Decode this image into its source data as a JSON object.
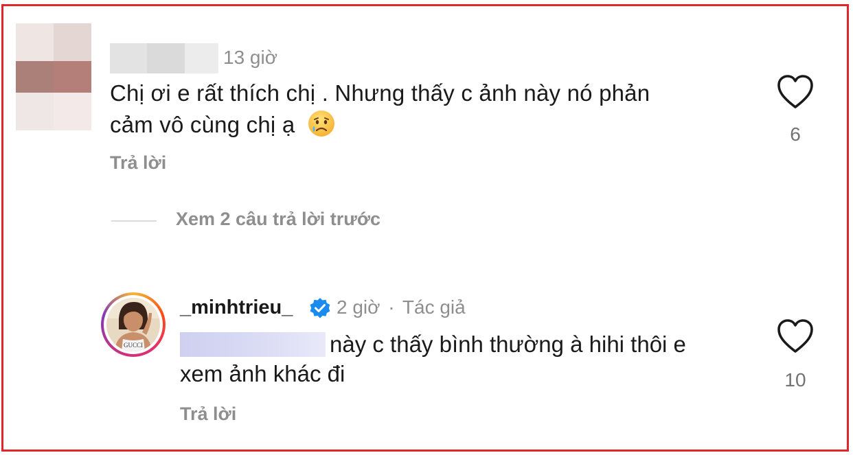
{
  "comment1": {
    "time": "13 giờ",
    "text_line1": "Chị ơi e rất thích chị . Nhưng thấy c ảnh này nó phản",
    "text_line2": "cảm vô cùng chị ạ",
    "emoji": "crying-face-emoji",
    "reply_label": "Trả lời",
    "like_count": "6",
    "like_icon": "heart-outline-icon",
    "avatar_blur_colors": [
      "#efe6e4",
      "#e3d6d3",
      "#ab8078",
      "#b57f79",
      "#efe7e5",
      "#f3e9e8"
    ],
    "name_blur_colors": [
      "#e3e3e3",
      "#dadada",
      "#ececec"
    ]
  },
  "view_replies": {
    "label": "Xem 2 câu trả lời trước"
  },
  "comment2": {
    "username": "_minhtrieu_",
    "verified_icon": "verified-badge-icon",
    "time": "2 giờ",
    "separator": "·",
    "author_tag": "Tác giả",
    "text_line1": "này c thấy bình thường à hihi thôi e",
    "text_line2": "xem ảnh khác đi",
    "reply_label": "Trả lời",
    "like_count": "10",
    "like_icon": "heart-outline-icon"
  },
  "colors": {
    "frame_border": "#e0262a",
    "secondary_text": "#8e8e8e",
    "primary_text": "#1a1a1a",
    "verified_blue": "#1a8cf0"
  }
}
